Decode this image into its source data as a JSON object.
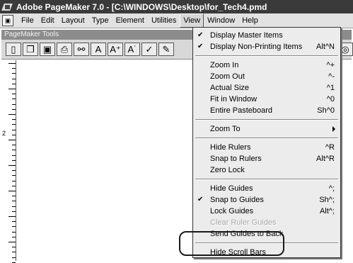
{
  "window": {
    "title": "Adobe PageMaker 7.0 - [C:\\WINDOWS\\Desktop\\for_Tech4.pmd"
  },
  "menubar": {
    "items": [
      {
        "label": "File",
        "active": false
      },
      {
        "label": "Edit",
        "active": false
      },
      {
        "label": "Layout",
        "active": false
      },
      {
        "label": "Type",
        "active": false
      },
      {
        "label": "Element",
        "active": false
      },
      {
        "label": "Utilities",
        "active": false
      },
      {
        "label": "View",
        "active": true
      },
      {
        "label": "Window",
        "active": false
      },
      {
        "label": "Help",
        "active": false
      }
    ]
  },
  "tools_window": {
    "title": "PageMaker Tools",
    "buttons": [
      {
        "icon": "new-document-icon",
        "glyph": "▯"
      },
      {
        "icon": "open-folder-icon",
        "glyph": "❐"
      },
      {
        "icon": "save-disk-icon",
        "glyph": "▣"
      },
      {
        "icon": "print-icon",
        "glyph": "⎙"
      },
      {
        "icon": "find-binoculars-icon",
        "glyph": "⚯"
      },
      {
        "icon": "character-icon",
        "glyph": "A"
      },
      {
        "icon": "superscript-icon",
        "glyph": "A⁺"
      },
      {
        "icon": "subscript-icon",
        "glyph": "A˙"
      },
      {
        "icon": "spell-check-icon",
        "glyph": "✓"
      },
      {
        "icon": "edit-icon",
        "glyph": "✎"
      }
    ],
    "right_button": {
      "icon": "zoom-icon",
      "glyph": "◎"
    }
  },
  "ruler": {
    "labels": [
      "2"
    ]
  },
  "view_menu": {
    "items": [
      {
        "type": "item",
        "label": "Display Master Items",
        "shortcut": "",
        "checked": true,
        "disabled": false
      },
      {
        "type": "item",
        "label": "Display Non-Printing Items",
        "shortcut": "Alt^N",
        "checked": true,
        "disabled": false
      },
      {
        "type": "separator"
      },
      {
        "type": "item",
        "label": "Zoom In",
        "shortcut": "^+",
        "checked": false,
        "disabled": false
      },
      {
        "type": "item",
        "label": "Zoom Out",
        "shortcut": "^-",
        "checked": false,
        "disabled": false
      },
      {
        "type": "item",
        "label": "Actual Size",
        "shortcut": "^1",
        "checked": false,
        "disabled": false
      },
      {
        "type": "item",
        "label": "Fit in Window",
        "shortcut": "^0",
        "checked": false,
        "disabled": false
      },
      {
        "type": "item",
        "label": "Entire Pasteboard",
        "shortcut": "Sh^0",
        "checked": false,
        "disabled": false
      },
      {
        "type": "separator"
      },
      {
        "type": "submenu",
        "label": "Zoom To",
        "shortcut": "",
        "checked": false,
        "disabled": false
      },
      {
        "type": "separator"
      },
      {
        "type": "item",
        "label": "Hide Rulers",
        "shortcut": "^R",
        "checked": false,
        "disabled": false
      },
      {
        "type": "item",
        "label": "Snap to Rulers",
        "shortcut": "Alt^R",
        "checked": false,
        "disabled": false
      },
      {
        "type": "item",
        "label": "Zero Lock",
        "shortcut": "",
        "checked": false,
        "disabled": false
      },
      {
        "type": "separator"
      },
      {
        "type": "item",
        "label": "Hide Guides",
        "shortcut": "^;",
        "checked": false,
        "disabled": false
      },
      {
        "type": "item",
        "label": "Snap to Guides",
        "shortcut": "Sh^;",
        "checked": true,
        "disabled": false
      },
      {
        "type": "item",
        "label": "Lock Guides",
        "shortcut": "Alt^;",
        "checked": false,
        "disabled": false
      },
      {
        "type": "item",
        "label": "Clear Ruler Guides",
        "shortcut": "",
        "checked": false,
        "disabled": true
      },
      {
        "type": "item",
        "label": "Send Guides to Back",
        "shortcut": "",
        "checked": false,
        "disabled": false
      },
      {
        "type": "separator"
      },
      {
        "type": "item",
        "label": "Hide Scroll Bars",
        "shortcut": "",
        "checked": false,
        "disabled": false
      }
    ]
  },
  "colors": {
    "titlebar": "#3a3a3a",
    "menu_bg": "#ececec",
    "highlight_outline": "#1a1a1a"
  }
}
